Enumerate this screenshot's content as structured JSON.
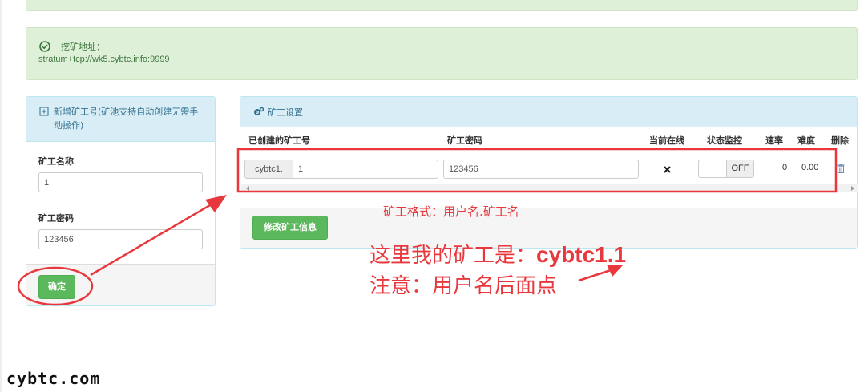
{
  "address_alert": {
    "label": "挖矿地址：",
    "url": "stratum+tcp://wk5.cybtc.info:9999",
    "icon": "check-circle-icon"
  },
  "new_worker_panel": {
    "title": "新增矿工号(矿池支持自动创建无需手动操作)",
    "icon": "plus-square-icon",
    "fields": [
      {
        "label": "矿工名称",
        "value": "1"
      },
      {
        "label": "矿工密码",
        "value": "123456"
      }
    ],
    "confirm_label": "确定"
  },
  "worker_settings_panel": {
    "title": "矿工设置",
    "icon": "cogs-icon",
    "columns": [
      "已创建的矿工号",
      "矿工密码",
      "当前在线",
      "状态监控",
      "速率",
      "难度",
      "删除"
    ],
    "rows": [
      {
        "prefix": "cybtc1.",
        "worker": "1",
        "password": "123456",
        "online_icon": "close-icon",
        "monitor_toggle": "OFF",
        "rate": "0",
        "difficulty": "0.00",
        "delete_icon": "trash-icon"
      }
    ],
    "modify_label": "修改矿工信息"
  },
  "annotations": {
    "format_note": "矿工格式：用户名.矿工名",
    "example_prefix": "这里我的矿工是：",
    "example_value": "cybtc1.1",
    "notice": "注意：用户名后面点"
  },
  "watermark": "cybtc.com",
  "colors": {
    "accent_red": "#e8383d",
    "success_bg": "#dff0d8",
    "info_bg": "#d9edf7",
    "button_green": "#5cb85c"
  }
}
